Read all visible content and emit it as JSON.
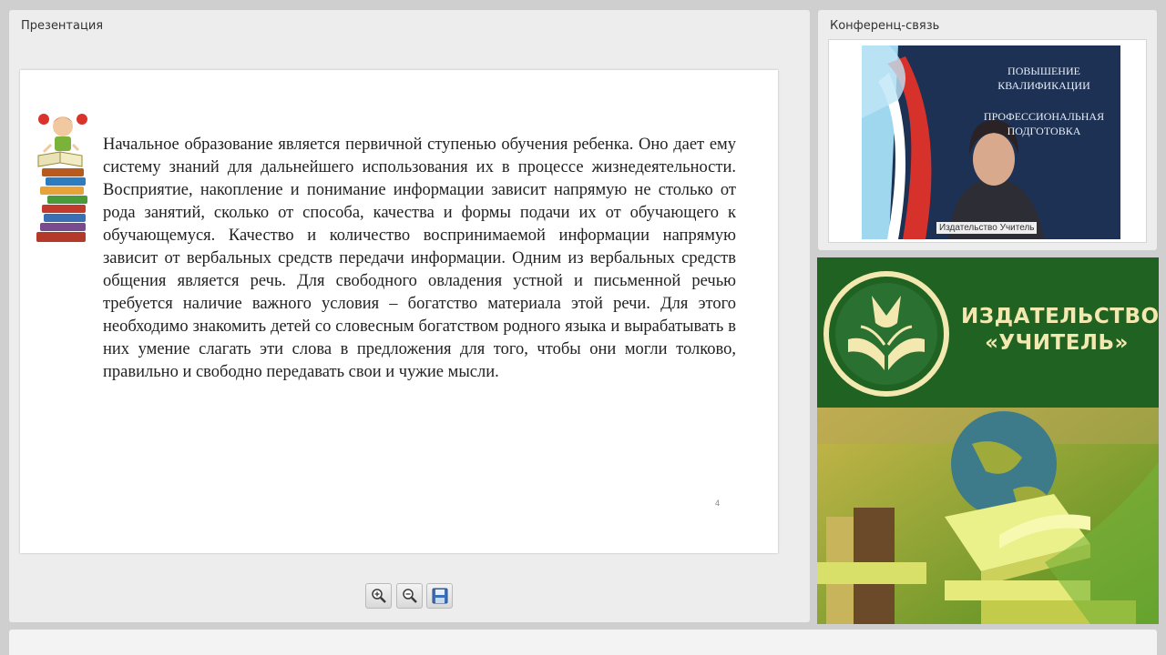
{
  "presentation": {
    "title": "Презентация",
    "slide": {
      "text": "Начальное образование является первичной ступенью обучения ребенка. Оно дает ему систему знаний для дальнейшего использования их в процессе жизнедеятельности. Восприятие, накопление и понимание информации зависит напрямую не столько от рода занятий, сколько от способа, качества и формы подачи их от обучающего к обучающемуся. Качество и количество воспринимаемой информации напрямую зависит от вербальных средств передачи информации. Одним из вербальных средств общения является речь. Для свободного овладения устной и письменной речью требуется наличие важного условия – богатство материала этой речи. Для этого необходимо знакомить детей со словесным богатством родного языка и вырабатывать в них умение слагать эти слова в предложения для того, чтобы они могли толково, правильно и свободно передавать свои и чужие мысли.",
      "page_number": "4",
      "illustration": "girl-on-books-illustration"
    },
    "toolbar": [
      {
        "name": "zoom-in-button",
        "icon": "zoom-in-icon"
      },
      {
        "name": "zoom-out-button",
        "icon": "zoom-out-icon"
      },
      {
        "name": "save-button",
        "icon": "floppy-disk-icon"
      }
    ]
  },
  "conference": {
    "title": "Конференц-связь",
    "video": {
      "caption": "Издательство Учитель",
      "poster_lines": {
        "line1": "ПОВЫШЕНИЕ",
        "line2": "КВАЛИФИКАЦИИ",
        "line3": "ПРОФЕССИОНАЛЬНАЯ",
        "line4": "ПОДГОТОВКА"
      }
    }
  },
  "brand": {
    "line1": "ИЗДАТЕЛЬСТВО",
    "line2": "«УЧИТЕЛЬ»",
    "colors": {
      "green": "#206221",
      "gold": "#f3e8b0"
    }
  }
}
